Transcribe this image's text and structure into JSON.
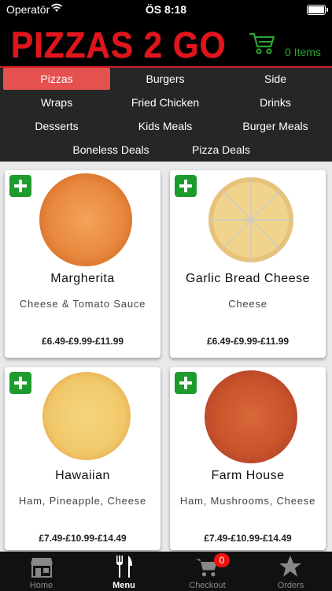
{
  "status": {
    "carrier": "Operatör",
    "time": "ÖS 8:18",
    "battery_level": 0.9
  },
  "header": {
    "logo": "PIZZAS 2 GO",
    "cart_count": "0 Items"
  },
  "categories": [
    {
      "label": "Pizzas",
      "active": true
    },
    {
      "label": "Burgers"
    },
    {
      "label": "Side"
    },
    {
      "label": "Wraps"
    },
    {
      "label": "Fried Chicken"
    },
    {
      "label": "Drinks"
    },
    {
      "label": "Desserts"
    },
    {
      "label": "Kids Meals"
    },
    {
      "label": "Burger Meals"
    },
    {
      "label": "Boneless Deals"
    },
    {
      "label": "Pizza Deals"
    }
  ],
  "products": [
    {
      "name": "Margherita",
      "description": "Cheese & Tomato Sauce",
      "price": "£6.49-£9.99-£11.99"
    },
    {
      "name": "Garlic Bread Cheese",
      "description": "Cheese",
      "price": "£6.49-£9.99-£11.99"
    },
    {
      "name": "Hawaiian",
      "description": "Ham, Pineapple, Cheese",
      "price": "£7.49-£10.99-£14.49"
    },
    {
      "name": "Farm House",
      "description": "Ham, Mushrooms, Cheese",
      "price": "£7.49-£10.99-£14.49"
    }
  ],
  "tabbar": {
    "items": [
      {
        "label": "Home",
        "icon": "store-icon"
      },
      {
        "label": "Menu",
        "icon": "fork-knife-icon",
        "active": true
      },
      {
        "label": "Checkout",
        "icon": "cart-icon"
      },
      {
        "label": "Orders",
        "icon": "star-icon"
      }
    ],
    "checkout_badge": "0"
  },
  "colors": {
    "brand_red": "#e1141c",
    "cart_green": "#2aa632",
    "add_green": "#1e9b2d",
    "active_tab_bg": "#e4514e"
  }
}
